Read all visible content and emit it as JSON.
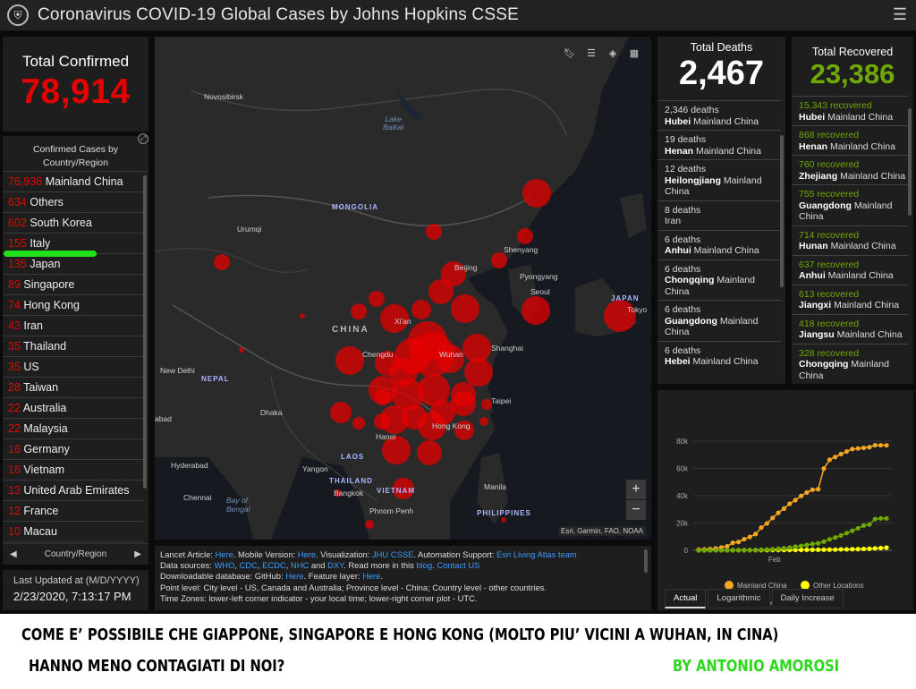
{
  "header": {
    "title": "Coronavirus COVID-19 Global Cases by Johns Hopkins CSSE",
    "menu_icon": "hamburger-icon",
    "logo_icon": "jhu-shield-icon"
  },
  "confirmed": {
    "label": "Total Confirmed",
    "value": "78,914",
    "color": "#e60000"
  },
  "countries": {
    "title": "Confirmed Cases by Country/Region",
    "items": [
      {
        "count": "76,936",
        "name": "Mainland China"
      },
      {
        "count": "634",
        "name": "Others"
      },
      {
        "count": "602",
        "name": "South Korea"
      },
      {
        "count": "155",
        "name": "Italy"
      },
      {
        "count": "135",
        "name": "Japan"
      },
      {
        "count": "89",
        "name": "Singapore"
      },
      {
        "count": "74",
        "name": "Hong Kong"
      },
      {
        "count": "43",
        "name": "Iran"
      },
      {
        "count": "35",
        "name": "Thailand"
      },
      {
        "count": "35",
        "name": "US"
      },
      {
        "count": "28",
        "name": "Taiwan"
      },
      {
        "count": "22",
        "name": "Australia"
      },
      {
        "count": "22",
        "name": "Malaysia"
      },
      {
        "count": "16",
        "name": "Germany"
      },
      {
        "count": "16",
        "name": "Vietnam"
      },
      {
        "count": "13",
        "name": "United Arab Emirates"
      },
      {
        "count": "12",
        "name": "France"
      },
      {
        "count": "10",
        "name": "Macau"
      }
    ],
    "pager_label": "Country/Region",
    "prev": "◀",
    "next": "▶"
  },
  "updated": {
    "label": "Last Updated at (M/D/YYYY)",
    "value": "2/23/2020, 7:13:17 PM"
  },
  "map": {
    "labels": {
      "novosibirsk": "Novosibirsk",
      "lake_baikal": "Lake\nBaikal",
      "mongolia": "MONGOLIA",
      "urumqi": "Urumqi",
      "shenyang": "Shenyang",
      "beijing": "Beijing",
      "pyongyang": "Pyongyang",
      "seoul": "Seoul",
      "japan": "JAPAN",
      "tokyo": "Tokyo",
      "xian": "Xi'an",
      "china": "CHINA",
      "chengdu": "Chengdu",
      "wuhan": "Wuhan",
      "shanghai": "Shanghai",
      "new_delhi": "New Delhi",
      "nepal": "NEPAL",
      "abad": "abad",
      "dhaka": "Dhaka",
      "taipei": "Taipei",
      "hanoi": "Hanoi",
      "hong_kong": "Hong Kong",
      "hyderabad": "Hyderabad",
      "laos": "LAOS",
      "yangon": "Yangon",
      "thailand": "THAILAND",
      "bangkok": "Bangkok",
      "vietnam": "VIETNAM",
      "manila": "Manila",
      "chennai": "Chennai",
      "bay_of_bengal": "Bay of\nBengal",
      "phnom_penh": "Phnom Penh",
      "philippines": "PHILIPPINES"
    },
    "attribution": "Esri, Garmin, FAO, NOAA",
    "zoom_in": "+",
    "zoom_out": "−",
    "tools": [
      "bookmark-icon",
      "legend-icon",
      "layers-icon",
      "basemap-icon"
    ]
  },
  "info": {
    "l1a": "Lancet Article: ",
    "l1b": "Here",
    "l1c": ". Mobile Version: ",
    "l1d": "Here",
    "l1e": ". Visualization: ",
    "l1f": "JHU CSSE",
    "l1g": ". Automation Support: ",
    "l1h": "Esri Living Atlas team",
    "l2a": "Data sources: ",
    "l2b": "WHO",
    "l2c": ", ",
    "l2d": "CDC",
    "l2e": ", ",
    "l2f": "ECDC",
    "l2g": ", ",
    "l2h": "NHC",
    "l2i": " and ",
    "l2j": "DXY",
    "l2k": ". Read more in this ",
    "l2l": "blog",
    "l2m": ". ",
    "l2n": "Contact US",
    "l3a": "Downloadable database: GitHub: ",
    "l3b": "Here",
    "l3c": ". Feature layer: ",
    "l3d": "Here",
    "l4": "Point level: City level - US, Canada and Australia; Province level - China; Country level - other countries.",
    "l5": "Time Zones: lower-left corner indicator - your local time; lower-right corner plot - UTC."
  },
  "deaths": {
    "label": "Total Deaths",
    "value": "2,467",
    "items": [
      {
        "count": "2,346 deaths",
        "region": "Hubei",
        "place": "Mainland China"
      },
      {
        "count": "19 deaths",
        "region": "Henan",
        "place": "Mainland China"
      },
      {
        "count": "12 deaths",
        "region": "Heilongjiang",
        "place": "Mainland China"
      },
      {
        "count": "8 deaths",
        "region": "",
        "place": "Iran"
      },
      {
        "count": "6 deaths",
        "region": "Anhui",
        "place": "Mainland China"
      },
      {
        "count": "6 deaths",
        "region": "Chongqing",
        "place": "Mainland China"
      },
      {
        "count": "6 deaths",
        "region": "Guangdong",
        "place": "Mainland China"
      },
      {
        "count": "6 deaths",
        "region": "Hebei",
        "place": "Mainland China"
      }
    ]
  },
  "recovered": {
    "label": "Total Recovered",
    "value": "23,386",
    "color": "#70a800",
    "items": [
      {
        "count": "15,343 recovered",
        "region": "Hubei",
        "place": "Mainland China"
      },
      {
        "count": "868 recovered",
        "region": "Henan",
        "place": "Mainland China"
      },
      {
        "count": "760 recovered",
        "region": "Zhejiang",
        "place": "Mainland China"
      },
      {
        "count": "755 recovered",
        "region": "Guangdong",
        "place": "Mainland China"
      },
      {
        "count": "714 recovered",
        "region": "Hunan",
        "place": "Mainland China"
      },
      {
        "count": "637 recovered",
        "region": "Anhui",
        "place": "Mainland China"
      },
      {
        "count": "613 recovered",
        "region": "Jiangxi",
        "place": "Mainland China"
      },
      {
        "count": "418 recovered",
        "region": "Jiangsu",
        "place": "Mainland China"
      },
      {
        "count": "328 recovered",
        "region": "Chongqing",
        "place": "Mainland China"
      }
    ]
  },
  "tabs": [
    "Actual",
    "Logarithmic",
    "Daily Increase"
  ],
  "chart_data": {
    "type": "line",
    "ylim": [
      0,
      80000
    ],
    "yticks": [
      0,
      20000,
      40000,
      60000,
      80000
    ],
    "yticklabels": [
      "0",
      "20k",
      "40k",
      "60k",
      "80k"
    ],
    "xticklabels": [
      "Feb"
    ],
    "legend_position": "bottom",
    "series": [
      {
        "name": "Mainland China",
        "color": "#f5a623",
        "values": [
          548,
          643,
          920,
          1406,
          2075,
          2877,
          5509,
          6087,
          8141,
          9802,
          11891,
          16630,
          19716,
          23707,
          27440,
          30587,
          34110,
          36814,
          39829,
          42354,
          44386,
          44759,
          59895,
          66358,
          68413,
          70513,
          72434,
          74211,
          74619,
          75077,
          75550,
          77001,
          77022,
          76936
        ]
      },
      {
        "name": "Other Locations",
        "color": "#ffff00",
        "values": [
          7,
          10,
          21,
          26,
          49,
          60,
          69,
          87,
          100,
          127,
          146,
          153,
          173,
          184,
          214,
          240,
          267,
          306,
          312,
          389,
          395,
          414,
          442,
          504,
          524,
          686,
          694,
          806,
          883,
          1016,
          1162,
          1429,
          1662,
          1978
        ]
      },
      {
        "name": "Total Recovered",
        "color": "#70a800",
        "values": [
          28,
          30,
          36,
          39,
          52,
          61,
          107,
          126,
          143,
          222,
          284,
          472,
          623,
          852,
          1124,
          1487,
          2011,
          2616,
          3244,
          3946,
          4683,
          5150,
          6295,
          8058,
          9395,
          10865,
          12583,
          14352,
          16121,
          18177,
          18890,
          22886,
          23394,
          23386
        ]
      }
    ]
  },
  "caption": {
    "line1": "COME E’ POSSIBILE CHE GIAPPONE, SINGAPORE E HONG KONG (MOLTO PIU’ VICINI A WUHAN, IN CINA)",
    "line2": "HANNO MENO CONTAGIATI DI NOI?",
    "author": "BY ANTONIO AMOROSI",
    "author_color": "#2bd91a",
    "highlight_color": "#22e01a"
  }
}
